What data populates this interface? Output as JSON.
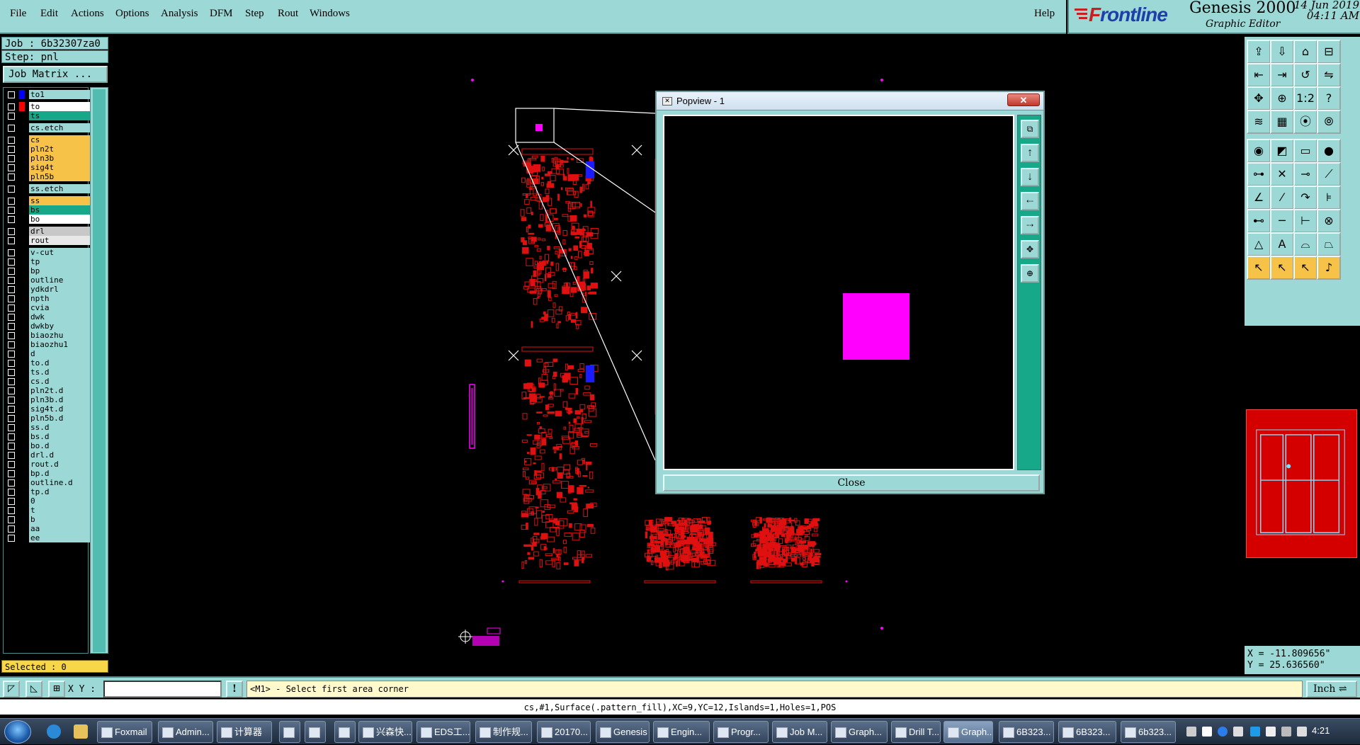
{
  "menu": [
    "File",
    "Edit",
    "Actions",
    "Options",
    "Analysis",
    "DFM",
    "Step",
    "Rout",
    "Windows"
  ],
  "help": "Help",
  "brand": {
    "logo_f": "F",
    "logo_rest": "rontline",
    "title": "Genesis 2000",
    "subtitle": "Graphic Editor",
    "date": "14 Jun 2019",
    "time": "04:11 AM"
  },
  "job": {
    "job_label": "Job : 6b32307za0",
    "step_label": "Step: pnl",
    "matrix_button": "Job Matrix ..."
  },
  "layers": [
    {
      "name": "to1",
      "color": "#9cd8d6",
      "swatch": "#0000ff"
    },
    {
      "name": "to",
      "color": "#ffffff",
      "swatch": "#ff0000"
    },
    {
      "name": "ts",
      "color": "#17a889",
      "swatch": "#000000"
    },
    {
      "name": "cs.etch",
      "color": "#9cd8d6",
      "swatch": "#000000"
    },
    {
      "name": "cs",
      "color": "#f7c248",
      "swatch": "#000000"
    },
    {
      "name": "pln2t",
      "color": "#f7c248",
      "swatch": "#000000"
    },
    {
      "name": "pln3b",
      "color": "#f7c248",
      "swatch": "#000000"
    },
    {
      "name": "sig4t",
      "color": "#f7c248",
      "swatch": "#000000"
    },
    {
      "name": "pln5b",
      "color": "#f7c248",
      "swatch": "#000000"
    },
    {
      "name": "ss.etch",
      "color": "#9cd8d6",
      "swatch": "#000000"
    },
    {
      "name": "ss",
      "color": "#f7c248",
      "swatch": "#000000"
    },
    {
      "name": "bs",
      "color": "#17a889",
      "swatch": "#000000"
    },
    {
      "name": "bo",
      "color": "#ffffff",
      "swatch": "#000000"
    },
    {
      "name": "drl",
      "color": "#c8c8c8",
      "swatch": "#000000"
    },
    {
      "name": "rout",
      "color": "#e8e8e8",
      "swatch": "#000000"
    },
    {
      "name": "v-cut",
      "color": "#9cd8d6",
      "swatch": "#000000"
    },
    {
      "name": "tp",
      "color": "#9cd8d6",
      "swatch": "#000000"
    },
    {
      "name": "bp",
      "color": "#9cd8d6",
      "swatch": "#000000"
    },
    {
      "name": "outline",
      "color": "#9cd8d6",
      "swatch": "#000000"
    },
    {
      "name": "ydkdrl",
      "color": "#9cd8d6",
      "swatch": "#000000"
    },
    {
      "name": "npth",
      "color": "#9cd8d6",
      "swatch": "#000000"
    },
    {
      "name": "cvia",
      "color": "#9cd8d6",
      "swatch": "#000000"
    },
    {
      "name": "dwk",
      "color": "#9cd8d6",
      "swatch": "#000000"
    },
    {
      "name": "dwkby",
      "color": "#9cd8d6",
      "swatch": "#000000"
    },
    {
      "name": "biaozhu",
      "color": "#9cd8d6",
      "swatch": "#000000"
    },
    {
      "name": "biaozhu1",
      "color": "#9cd8d6",
      "swatch": "#000000"
    },
    {
      "name": "d",
      "color": "#9cd8d6",
      "swatch": "#000000"
    },
    {
      "name": "to.d",
      "color": "#9cd8d6",
      "swatch": "#000000"
    },
    {
      "name": "ts.d",
      "color": "#9cd8d6",
      "swatch": "#000000"
    },
    {
      "name": "cs.d",
      "color": "#9cd8d6",
      "swatch": "#000000"
    },
    {
      "name": "pln2t.d",
      "color": "#9cd8d6",
      "swatch": "#000000"
    },
    {
      "name": "pln3b.d",
      "color": "#9cd8d6",
      "swatch": "#000000"
    },
    {
      "name": "sig4t.d",
      "color": "#9cd8d6",
      "swatch": "#000000"
    },
    {
      "name": "pln5b.d",
      "color": "#9cd8d6",
      "swatch": "#000000"
    },
    {
      "name": "ss.d",
      "color": "#9cd8d6",
      "swatch": "#000000"
    },
    {
      "name": "bs.d",
      "color": "#9cd8d6",
      "swatch": "#000000"
    },
    {
      "name": "bo.d",
      "color": "#9cd8d6",
      "swatch": "#000000"
    },
    {
      "name": "drl.d",
      "color": "#9cd8d6",
      "swatch": "#000000"
    },
    {
      "name": "rout.d",
      "color": "#9cd8d6",
      "swatch": "#000000"
    },
    {
      "name": "bp.d",
      "color": "#9cd8d6",
      "swatch": "#000000"
    },
    {
      "name": "outline.d",
      "color": "#9cd8d6",
      "swatch": "#000000"
    },
    {
      "name": "tp.d",
      "color": "#9cd8d6",
      "swatch": "#000000"
    },
    {
      "name": "0",
      "color": "#9cd8d6",
      "swatch": "#000000"
    },
    {
      "name": "t",
      "color": "#9cd8d6",
      "swatch": "#000000"
    },
    {
      "name": "b",
      "color": "#9cd8d6",
      "swatch": "#000000"
    },
    {
      "name": "aa",
      "color": "#9cd8d6",
      "swatch": "#000000"
    },
    {
      "name": "ee",
      "color": "#9cd8d6",
      "swatch": "#000000"
    }
  ],
  "selected": "Selected : 0",
  "popview": {
    "title": "Popview - 1",
    "close_x": "✕",
    "close_button": "Close"
  },
  "coords": {
    "x": "X = -11.809656\"",
    "y": "Y = 25.636560\""
  },
  "status": {
    "xy_label": "X Y :",
    "xy_value": "",
    "info_icon": "!",
    "prompt": "<M1> - Select first area corner",
    "unit": "Inch ⇌"
  },
  "feature_line": "cs,#1,Surface(.pattern_fill),XC=9,YC=12,Islands=1,Holes=1,POS",
  "taskbar": {
    "tasks": [
      "Foxmail",
      "Admin...",
      "计算器",
      "",
      "",
      "",
      "兴森快...",
      "EDS工...",
      "制作规...",
      "20170...",
      "Genesis",
      "Engin...",
      "Progr...",
      "Job M...",
      "Graph...",
      "Drill T...",
      "Graph...",
      "6B323...",
      "6B323...",
      "6b323..."
    ],
    "active_index": 16,
    "clock": "4:21"
  },
  "colors": {
    "panel": "#9cd8d6",
    "accent": "#17a889",
    "yellow": "#f7c248",
    "pad": "#ff00ff",
    "trace": "#e01010"
  }
}
